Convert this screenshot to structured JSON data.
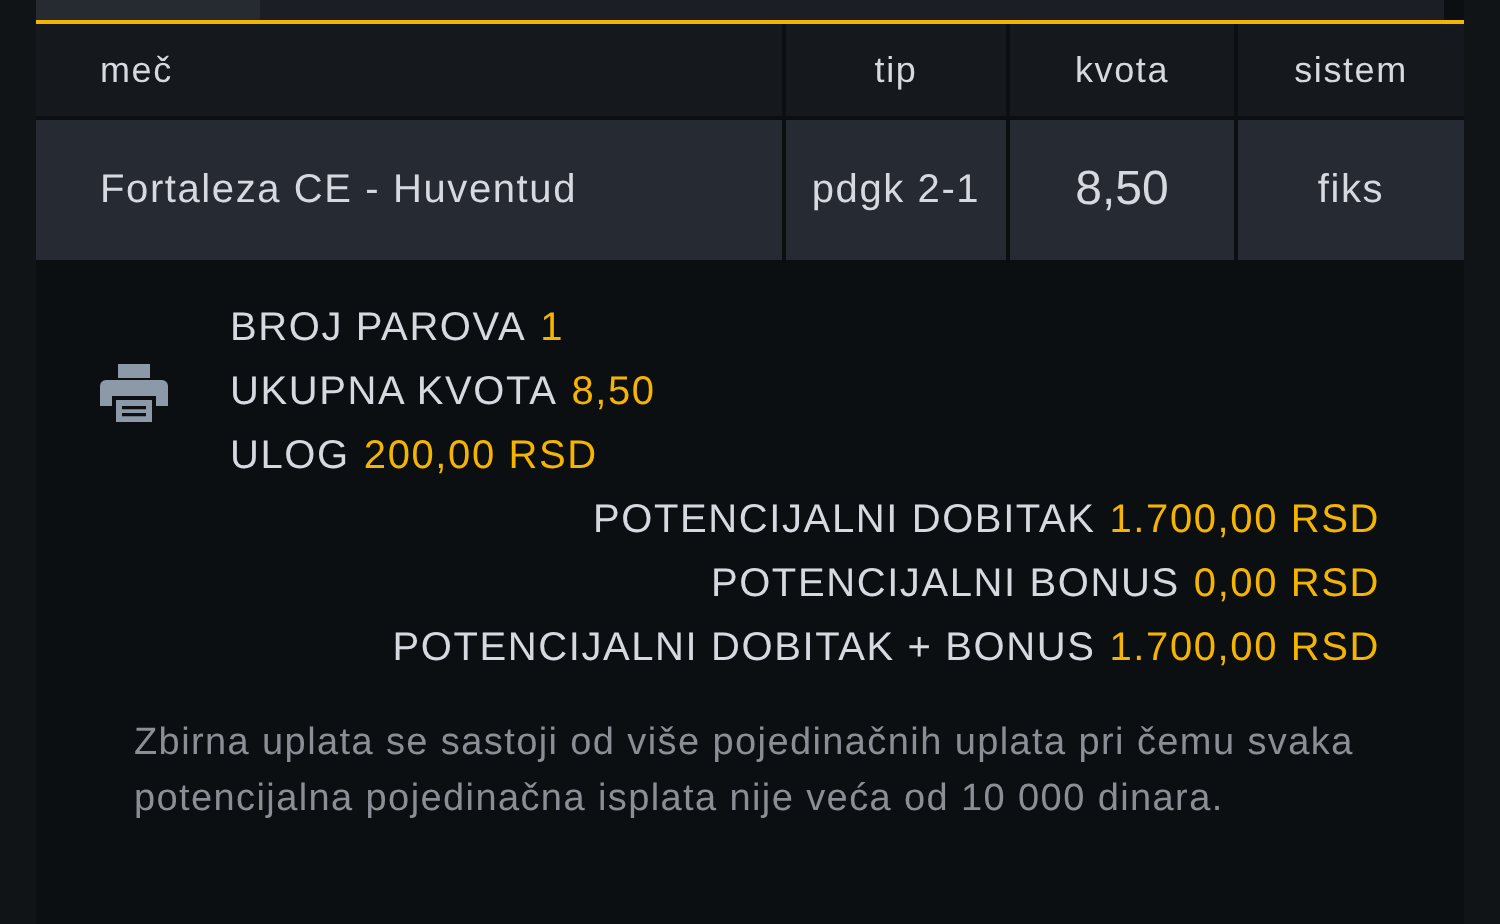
{
  "table": {
    "columns": [
      "meč",
      "tip",
      "kvota",
      "sistem"
    ],
    "rows": [
      {
        "match": "Fortaleza CE - Huventud",
        "tip": "pdgk 2-1",
        "kvota": "8,50",
        "sistem": "fiks"
      }
    ]
  },
  "summary": {
    "details": [
      {
        "label": "BROJ PAROVA",
        "value": "1"
      },
      {
        "label": "UKUPNA KVOTA",
        "value": "8,50"
      },
      {
        "label": "ULOG",
        "value": "200,00 RSD"
      }
    ],
    "totals": [
      {
        "label": "POTENCIJALNI DOBITAK",
        "value": "1.700,00 RSD"
      },
      {
        "label": "POTENCIJALNI BONUS",
        "value": "0,00 RSD"
      },
      {
        "label": "POTENCIJALNI DOBITAK + BONUS",
        "value": "1.700,00 RSD"
      }
    ]
  },
  "note": "Zbirna uplata se sastoji od više pojedinačnih uplata pri čemu svaka potencijalna pojedinačna isplata nije veća od 10 000 dinara."
}
